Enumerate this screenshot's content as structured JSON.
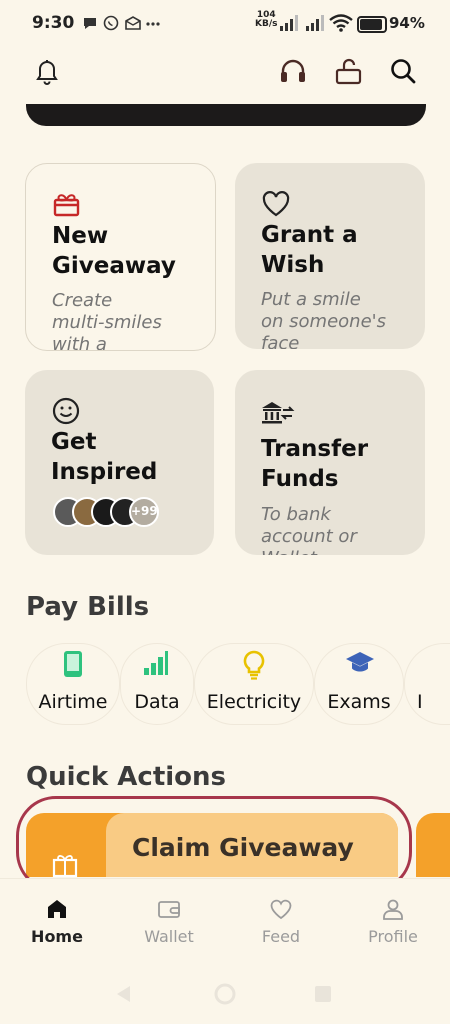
{
  "status_bar": {
    "time": "9:30",
    "net_speed_value": "104",
    "net_speed_unit": "KB/s",
    "battery": "94%"
  },
  "header": {
    "icons": [
      "bell-icon",
      "headset-icon",
      "unlock-icon",
      "search-icon"
    ]
  },
  "cards": [
    {
      "title": "New\nGiveaway",
      "subtitle": "Create\nmulti-smiles\nwith a\ngiveaway",
      "icon": "gift-icon"
    },
    {
      "title": "Grant a\nWish",
      "subtitle": "Put a smile\non someone's\nface",
      "icon": "heart-icon"
    },
    {
      "title": "Get\nInspired",
      "subtitle": "",
      "icon": "smile-icon",
      "avatars_more": "+99"
    },
    {
      "title": "Transfer\nFunds",
      "subtitle": "To bank\naccount or\nWallet",
      "icon": "bank-transfer-icon"
    }
  ],
  "pay_bills": {
    "title": "Pay Bills",
    "items": [
      {
        "label": "Airtime",
        "icon": "phone-icon"
      },
      {
        "label": "Data",
        "icon": "signal-bars-icon"
      },
      {
        "label": "Electricity",
        "icon": "lightbulb-icon"
      },
      {
        "label": "Exams",
        "icon": "graduation-cap-icon"
      },
      {
        "label": "I",
        "icon": ""
      }
    ]
  },
  "quick_actions": {
    "title": "Quick Actions",
    "items": [
      {
        "title": "Claim Giveaway",
        "icon": "gift-icon"
      }
    ]
  },
  "bottom_nav": {
    "items": [
      {
        "label": "Home",
        "icon": "home-icon",
        "active": true
      },
      {
        "label": "Wallet",
        "icon": "wallet-icon",
        "active": false
      },
      {
        "label": "Feed",
        "icon": "heart-icon",
        "active": false
      },
      {
        "label": "Profile",
        "icon": "user-icon",
        "active": false
      }
    ]
  },
  "colors": {
    "background": "#fbf6ea",
    "card": "#e8e3d7",
    "accent_orange": "#f4a12a",
    "accent_red": "#c62828",
    "highlight_outline": "#a7374c"
  }
}
